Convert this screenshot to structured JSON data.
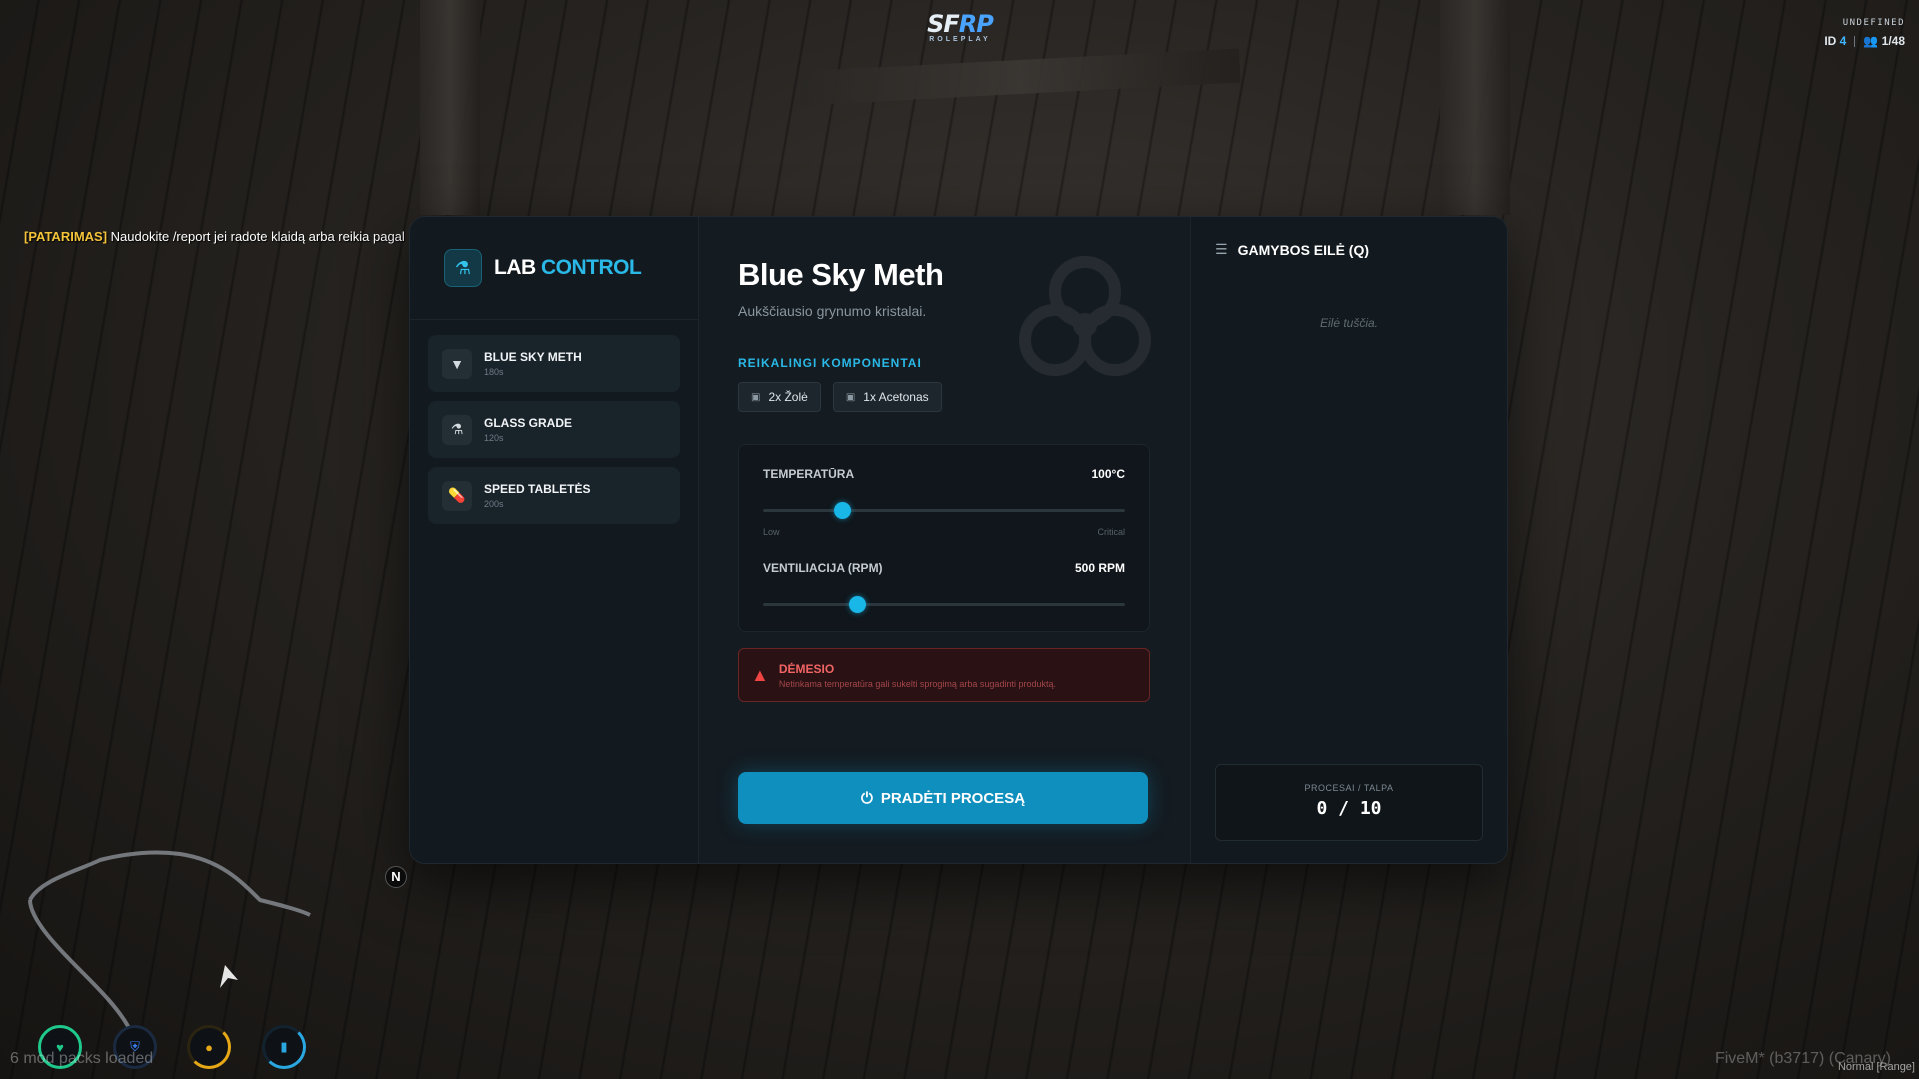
{
  "hud": {
    "logo_main": "SF",
    "logo_accent": "RP",
    "logo_sub": "ROLEPLAY",
    "status": "UNDEFINED",
    "id_label": "ID",
    "id_value": "4",
    "players": "1/48",
    "compass": "N",
    "mod_packs": "6 mod packs loaded",
    "fivem": "FiveM* (b3717) (Canary)",
    "voice_range": "Normal [Range]"
  },
  "chat": {
    "tag": "[PATARIMAS]",
    "message": "Naudokite /report jei radote klaidą arba reikia pagal"
  },
  "sidebar": {
    "title_main": "LAB",
    "title_accent": "CONTROL",
    "flask_icon": "flask-icon",
    "items": [
      {
        "name": "BLUE SKY METH",
        "time": "180s",
        "icon": "crystals-icon"
      },
      {
        "name": "GLASS GRADE",
        "time": "120s",
        "icon": "flask-icon"
      },
      {
        "name": "SPEED TABLETĖS",
        "time": "200s",
        "icon": "pills-icon"
      }
    ]
  },
  "product": {
    "title": "Blue Sky Meth",
    "description": "Aukščiausio grynumo kristalai.",
    "components_label": "REIKALINGI KOMPONENTAI",
    "components": [
      "2x Žolė",
      "1x Acetonas"
    ]
  },
  "controls": {
    "temperature": {
      "label": "TEMPERATŪRA",
      "value": "100°C",
      "level": 0.22,
      "low": "Low",
      "high": "Critical"
    },
    "ventilation": {
      "label": "VENTILIACIJA (RPM)",
      "value": "500 RPM",
      "level": 0.26
    }
  },
  "warning": {
    "title": "DĖMESIO",
    "text": "Netinkama temperatūra gali sukelti sprogimą arba sugadinti produktą."
  },
  "start_button": "PRADĖTI PROCESĄ",
  "queue": {
    "title": "GAMYBOS EILĖ (Q)",
    "empty": "Eilė tuščia.",
    "capacity_label": "PROCESAI / TALPA",
    "capacity_value": "0 / 10"
  },
  "colors": {
    "accent": "#2ab8e6",
    "button": "#0f8fbd",
    "warning": "#ef4444"
  }
}
